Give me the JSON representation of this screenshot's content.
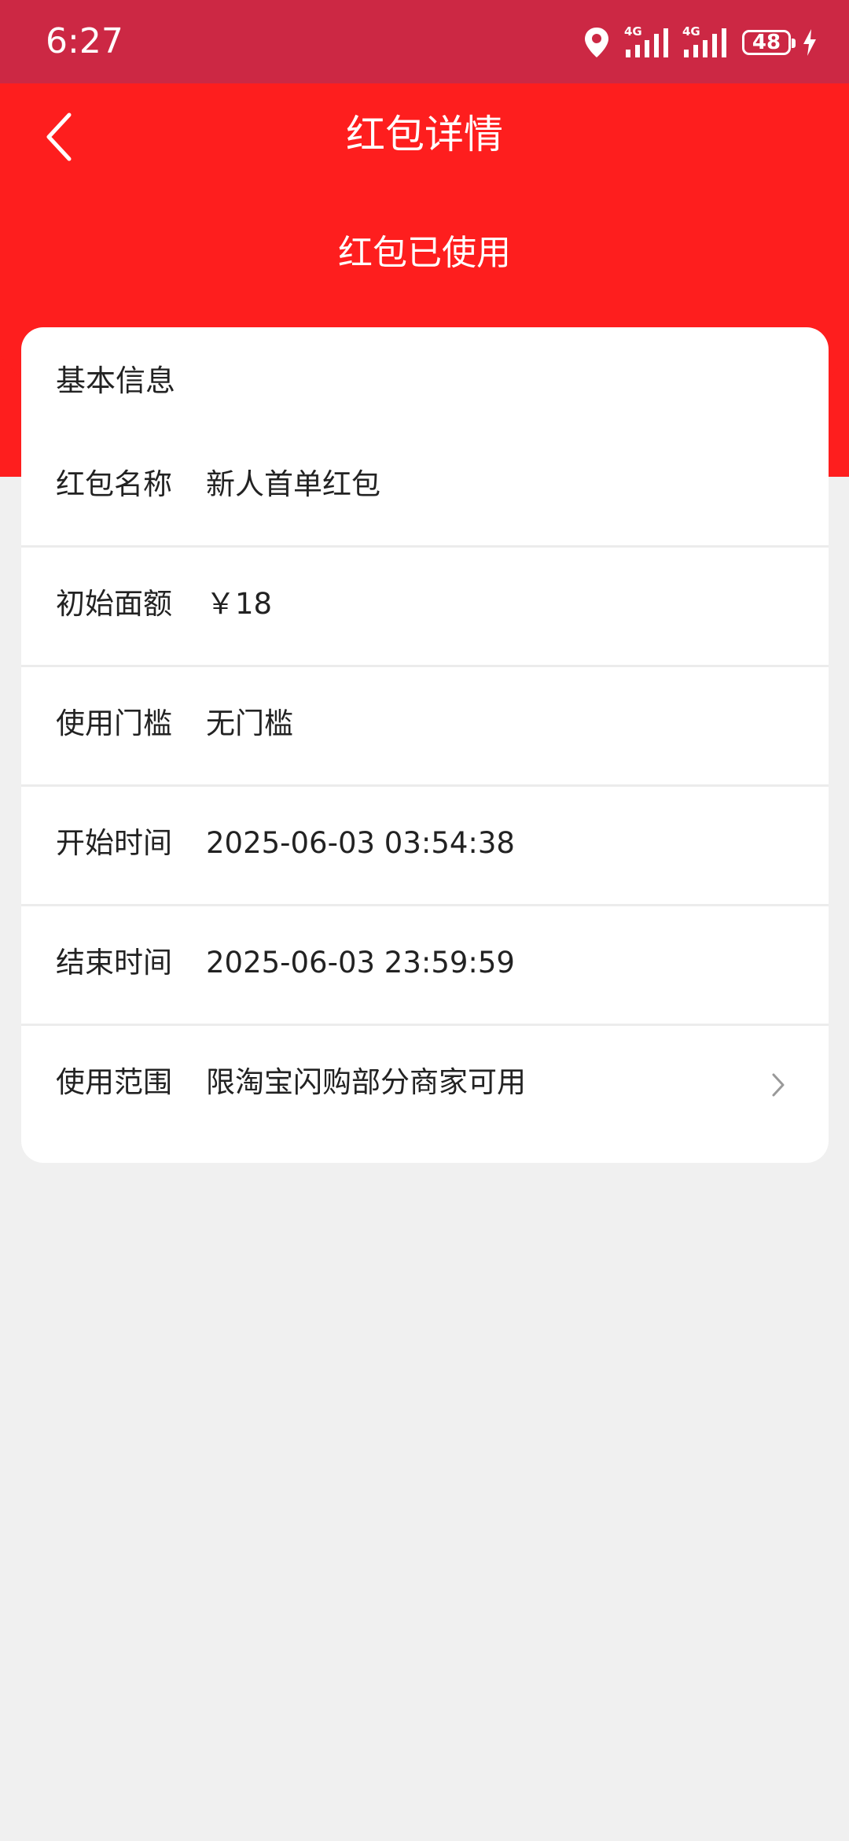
{
  "status_bar": {
    "time": "6:27",
    "battery": "48",
    "network_1": "4G",
    "network_2": "4G",
    "icons": [
      "location-icon",
      "signal-icon",
      "signal-icon",
      "battery-icon",
      "charging-icon"
    ]
  },
  "colors": {
    "status_bar": "#cc2844",
    "header": "#fe1e1e",
    "background": "#f0f0f0",
    "card": "#ffffff"
  },
  "header": {
    "back_icon": "chevron-left-icon",
    "title": "红包详情",
    "status": "红包已使用"
  },
  "card": {
    "title": "基本信息",
    "rows": [
      {
        "label": "红包名称",
        "value": "新人首单红包"
      },
      {
        "label": "初始面额",
        "value": "￥18"
      },
      {
        "label": "使用门槛",
        "value": "无门槛"
      },
      {
        "label": "开始时间",
        "value": "2025-06-03 03:54:38"
      },
      {
        "label": "结束时间",
        "value": "2025-06-03 23:59:59"
      },
      {
        "label": "使用范围",
        "value": "限淘宝闪购部分商家可用",
        "arrow_icon": "chevron-right-icon"
      }
    ]
  }
}
